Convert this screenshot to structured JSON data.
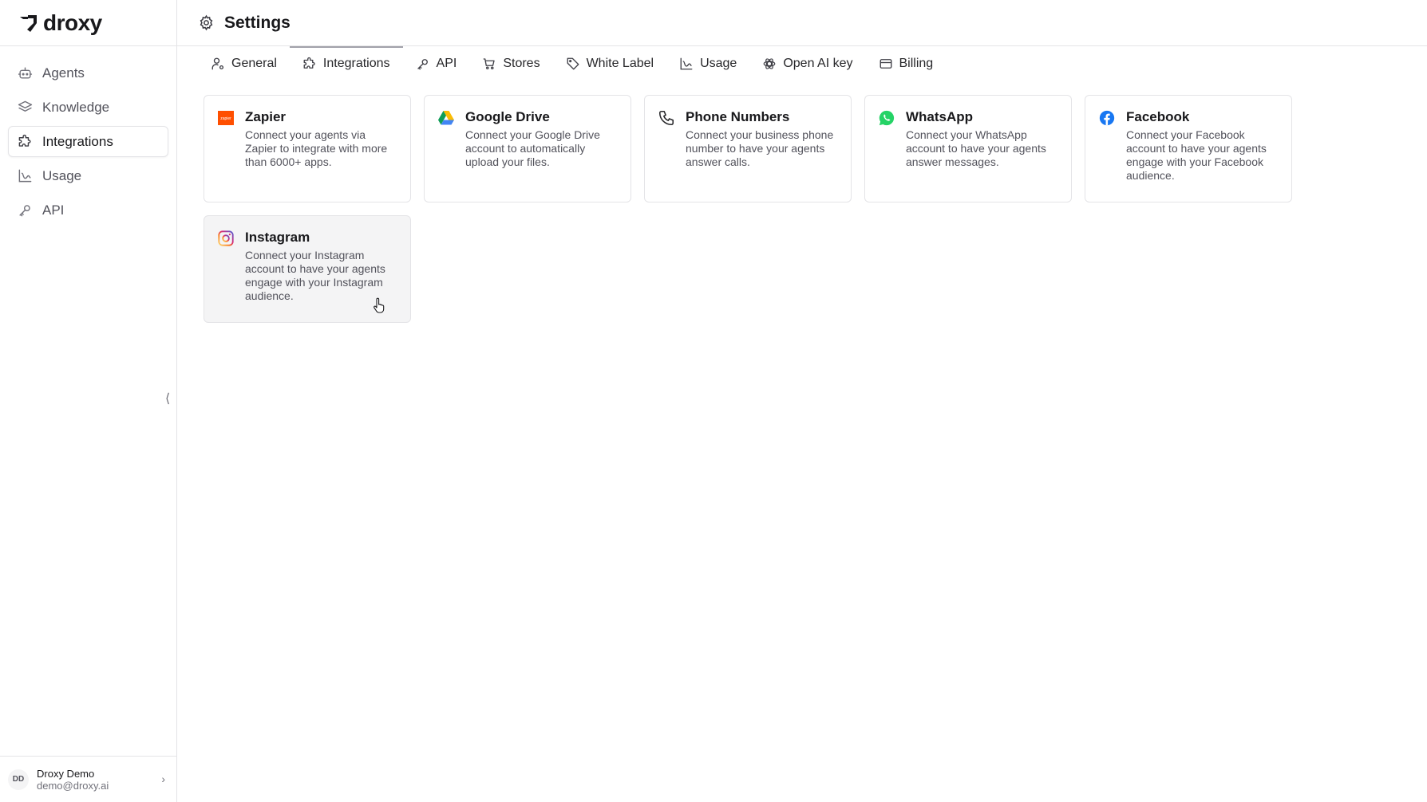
{
  "app": {
    "name": "droxy"
  },
  "sidebar": {
    "items": [
      {
        "label": "Agents",
        "icon": "bot-icon",
        "active": false
      },
      {
        "label": "Knowledge",
        "icon": "layers-icon",
        "active": false
      },
      {
        "label": "Integrations",
        "icon": "puzzle-icon",
        "active": true
      },
      {
        "label": "Usage",
        "icon": "chart-icon",
        "active": false
      },
      {
        "label": "API",
        "icon": "key-icon",
        "active": false
      }
    ],
    "collapse_glyph": "⟨"
  },
  "user": {
    "initials": "DD",
    "name": "Droxy Demo",
    "email": "demo@droxy.ai"
  },
  "header": {
    "title": "Settings"
  },
  "tabs": [
    {
      "label": "General",
      "icon": "user-cog-icon"
    },
    {
      "label": "Integrations",
      "icon": "puzzle-icon",
      "active": true
    },
    {
      "label": "API",
      "icon": "key-icon"
    },
    {
      "label": "Stores",
      "icon": "cart-icon"
    },
    {
      "label": "White Label",
      "icon": "tag-icon"
    },
    {
      "label": "Usage",
      "icon": "chart-icon"
    },
    {
      "label": "Open AI key",
      "icon": "openai-icon"
    },
    {
      "label": "Billing",
      "icon": "card-icon"
    }
  ],
  "integrations": [
    {
      "title": "Zapier",
      "description": "Connect your agents via Zapier to integrate with more than 6000+ apps.",
      "icon": "zapier-icon",
      "logo_text": "zapier",
      "color": "#ff4f00"
    },
    {
      "title": "Google Drive",
      "description": "Connect your Google Drive account to automatically upload your files.",
      "icon": "google-drive-icon"
    },
    {
      "title": "Phone Numbers",
      "description": "Connect your business phone number to have your agents answer calls.",
      "icon": "phone-icon"
    },
    {
      "title": "WhatsApp",
      "description": "Connect your WhatsApp account to have your agents answer messages.",
      "icon": "whatsapp-icon",
      "color": "#25d366"
    },
    {
      "title": "Facebook",
      "description": "Connect your Facebook account to have your agents engage with your Facebook audience.",
      "icon": "facebook-icon",
      "color": "#1877f2"
    },
    {
      "title": "Instagram",
      "description": "Connect your Instagram account to have your agents engage with your Instagram audience.",
      "icon": "instagram-icon",
      "color": "#e1306c"
    }
  ]
}
